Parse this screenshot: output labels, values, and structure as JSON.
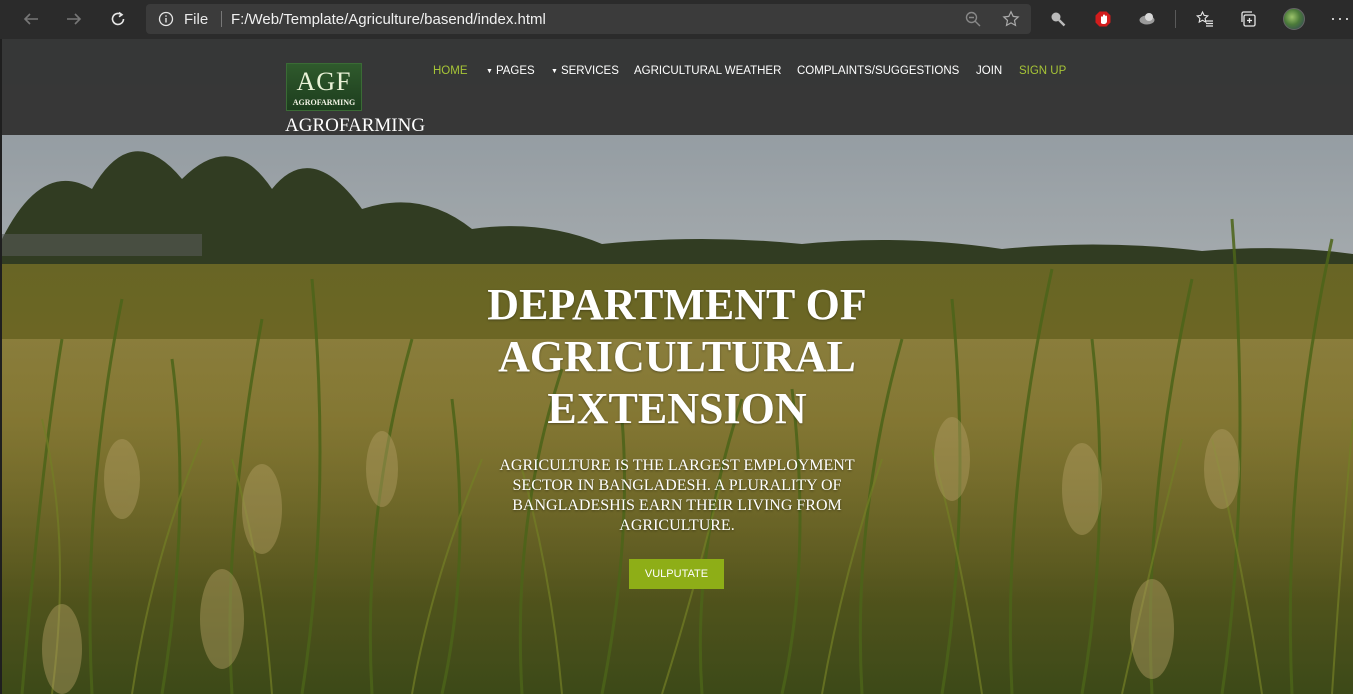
{
  "browser": {
    "file_label": "File",
    "url": "F:/Web/Template/Agriculture/basend/index.html",
    "more_label": "···",
    "icons": [
      "back-arrow-icon",
      "forward-arrow-icon",
      "refresh-icon",
      "info-icon",
      "zoom-out-icon",
      "star-icon",
      "search-extension-icon",
      "adblock-icon",
      "extension-icon",
      "favorites-icon",
      "collections-icon",
      "profile-avatar",
      "more-icon"
    ]
  },
  "site": {
    "logo_mark": "AGF",
    "logo_sub": "AGROFARMING",
    "brand": "AGROFARMING",
    "accent_color": "#a6c437",
    "button_color": "#8eae17",
    "nav": [
      {
        "label": "HOME",
        "active": true,
        "dropdown": false
      },
      {
        "label": "PAGES",
        "active": false,
        "dropdown": true
      },
      {
        "label": "SERVICES",
        "active": false,
        "dropdown": true
      },
      {
        "label": "AGRICULTURAL WEATHER",
        "active": false,
        "dropdown": false
      },
      {
        "label": "COMPLAINTS/SUGGESTIONS",
        "active": false,
        "dropdown": false
      },
      {
        "label": "JOIN",
        "active": false,
        "dropdown": false
      },
      {
        "label": "SIGN UP",
        "active": true,
        "dropdown": false
      }
    ]
  },
  "hero": {
    "title_lines": [
      "DEPARTMENT OF",
      "AGRICULTURAL",
      "EXTENSION"
    ],
    "subtitle_lines": [
      "AGRICULTURE IS THE LARGEST EMPLOYMENT",
      "SECTOR IN BANGLADESH. A PLURALITY OF",
      "BANGLADESHIS EARN THEIR LIVING FROM",
      "AGRICULTURE."
    ],
    "button_label": "VULPUTATE"
  }
}
